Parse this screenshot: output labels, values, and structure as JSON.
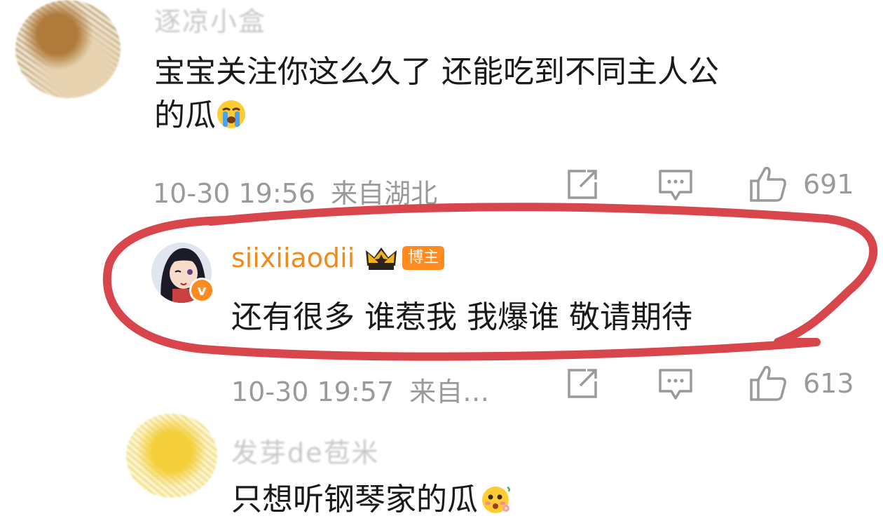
{
  "comments": [
    {
      "username": "逐凉小盒",
      "text": "宝宝关注你这么久了 还能吃到不同主人公的瓜",
      "text_line1": "宝宝关注你这么久了 还能吃到不同主人公",
      "text_line2": "的瓜",
      "timestamp": "10-30 19:56",
      "location": "来自湖北",
      "likes": "691"
    },
    {
      "username": "siixiiaodii",
      "badge": "博主",
      "text": "还有很多 谁惹我 我爆谁 敬请期待",
      "timestamp": "10-30 19:57",
      "location": "来自…",
      "likes": "613"
    },
    {
      "username": "发芽de苞米",
      "text": "只想听钢琴家的瓜"
    }
  ],
  "colors": {
    "accent_orange": "#f08a1c",
    "annotation_red": "#d8454b",
    "meta_gray": "#9a9a9a"
  },
  "icons": [
    "crying-emoji",
    "share-icon",
    "reply-icon",
    "like-icon",
    "crown-badge-icon",
    "verified-icon",
    "blushing-flower-emoji"
  ]
}
